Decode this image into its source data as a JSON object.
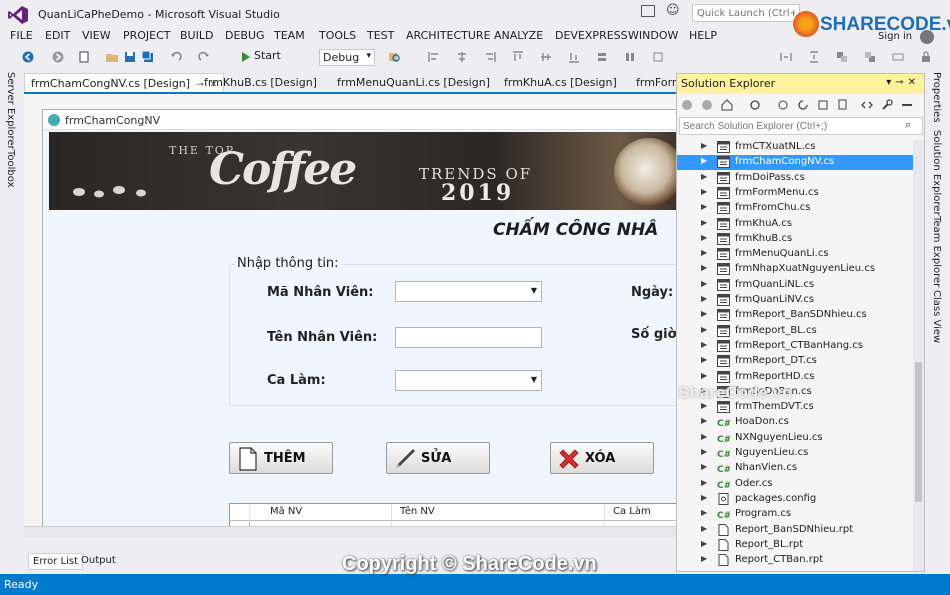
{
  "window": {
    "title": "QuanLiCaPheDemo - Microsoft Visual Studio",
    "quick_launch_placeholder": "Quick Launch (Ctrl+Q)",
    "sign_in": "Sign in"
  },
  "logo": {
    "text": "SHARECODE.vn"
  },
  "menu": [
    "FILE",
    "EDIT",
    "VIEW",
    "PROJECT",
    "BUILD",
    "DEBUG",
    "TEAM",
    "TOOLS",
    "TEST",
    "ARCHITECTURE",
    "ANALYZE",
    "DEVEXPRESS",
    "WINDOW",
    "HELP"
  ],
  "toolbar": {
    "start_label": "Start",
    "config": "Debug"
  },
  "left_rail": [
    "Server Explorer",
    "Toolbox"
  ],
  "right_rail": [
    "Properties",
    "Solution Explorer",
    "Team Explorer",
    "Class View"
  ],
  "doc_tabs": [
    "frmChamCongNV.cs [Design]",
    "frmKhuB.cs [Design]",
    "frmMenuQuanLi.cs [Design]",
    "frmKhuA.cs [Design]",
    "frmForm"
  ],
  "form": {
    "title": "frmChamCongNV",
    "banner": {
      "small": "THE TOP",
      "big": "Coffee",
      "trends": "TRENDS OF",
      "year": "2019"
    },
    "heading": "CHẤM CÔNG NHÂ",
    "group_label": "Nhập thông tin:",
    "labels": {
      "ma_nv": "Mã Nhân Viên:",
      "ten_nv": "Tên Nhân Viên:",
      "ca_lam": "Ca Làm:",
      "ngay": "Ngày:",
      "so_gio": "Số giờ"
    },
    "buttons": {
      "add": "THÊM",
      "edit": "SỬA",
      "delete": "XÓA"
    },
    "grid": {
      "columns": [
        "Mã NV",
        "Tên NV",
        "Ca Làm"
      ],
      "new_row_marker": "*"
    }
  },
  "bottom_tabs": [
    "Error List",
    "Output"
  ],
  "solution_explorer": {
    "title": "Solution Explorer",
    "search_placeholder": "Search Solution Explorer (Ctrl+;)",
    "items": [
      {
        "label": "frmCTXuatNL.cs",
        "icon": "form-icon",
        "selected": false
      },
      {
        "label": "frmChamCongNV.cs",
        "icon": "form-icon",
        "selected": true
      },
      {
        "label": "frmDoiPass.cs",
        "icon": "form-icon",
        "selected": false
      },
      {
        "label": "frmFormMenu.cs",
        "icon": "form-icon",
        "selected": false
      },
      {
        "label": "frmFromChu.cs",
        "icon": "form-icon",
        "selected": false
      },
      {
        "label": "frmKhuA.cs",
        "icon": "form-icon",
        "selected": false
      },
      {
        "label": "frmKhuB.cs",
        "icon": "form-icon",
        "selected": false
      },
      {
        "label": "frmMenuQuanLi.cs",
        "icon": "form-icon",
        "selected": false
      },
      {
        "label": "frmNhapXuatNguyenLieu.cs",
        "icon": "form-icon",
        "selected": false
      },
      {
        "label": "frmQuanLiNL.cs",
        "icon": "form-icon",
        "selected": false
      },
      {
        "label": "frmQuanLiNV.cs",
        "icon": "form-icon",
        "selected": false
      },
      {
        "label": "frmReport_BanSDNhieu.cs",
        "icon": "form-icon",
        "selected": false
      },
      {
        "label": "frmReport_BL.cs",
        "icon": "form-icon",
        "selected": false
      },
      {
        "label": "frmReport_CTBanHang.cs",
        "icon": "form-icon",
        "selected": false
      },
      {
        "label": "frmReport_DT.cs",
        "icon": "form-icon",
        "selected": false
      },
      {
        "label": "frmReportHD.cs",
        "icon": "form-icon",
        "selected": false
      },
      {
        "label": "frmSoDoBan.cs",
        "icon": "form-icon",
        "selected": false
      },
      {
        "label": "frmThemDVT.cs",
        "icon": "form-icon",
        "selected": false
      },
      {
        "label": "HoaDon.cs",
        "icon": "csharp-icon",
        "selected": false
      },
      {
        "label": "NXNguyenLieu.cs",
        "icon": "csharp-icon",
        "selected": false
      },
      {
        "label": "NguyenLieu.cs",
        "icon": "csharp-icon",
        "selected": false
      },
      {
        "label": "NhanVien.cs",
        "icon": "csharp-icon",
        "selected": false
      },
      {
        "label": "Oder.cs",
        "icon": "csharp-icon",
        "selected": false
      },
      {
        "label": "packages.config",
        "icon": "config-icon",
        "selected": false
      },
      {
        "label": "Program.cs",
        "icon": "csharp-icon",
        "selected": false
      },
      {
        "label": "Report_BanSDNhieu.rpt",
        "icon": "file-icon",
        "selected": false
      },
      {
        "label": "Report_BL.rpt",
        "icon": "file-icon",
        "selected": false
      },
      {
        "label": "Report_CTBan.rpt",
        "icon": "file-icon",
        "selected": false
      }
    ]
  },
  "status": {
    "text": "Ready"
  },
  "watermarks": {
    "bottom": "Copyright © ShareCode.vn",
    "middle": "ShareCode.vn"
  },
  "colors": {
    "accent": "#007acc",
    "selection": "#3399ff",
    "se_title": "#fff29d",
    "vs_purple": "#68217a"
  }
}
